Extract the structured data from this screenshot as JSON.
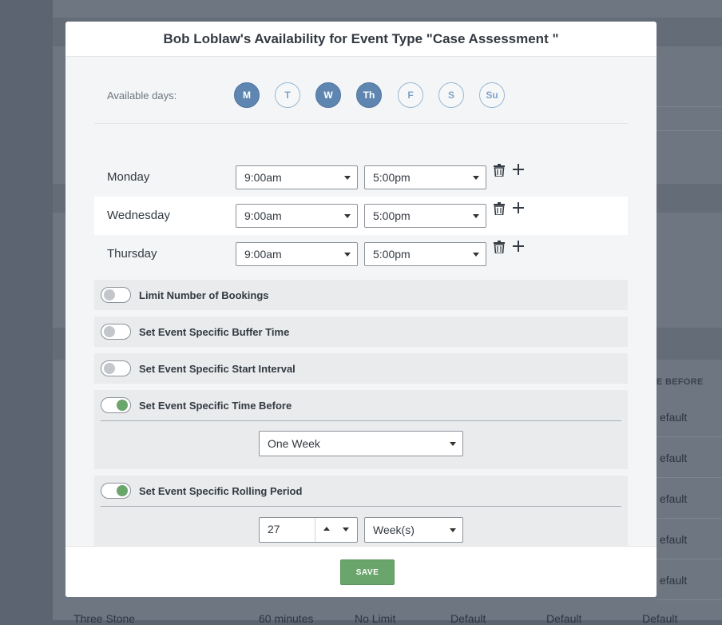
{
  "modal": {
    "title": "Bob Loblaw's Availability for Event Type \"Case Assessment \"",
    "available_days_label": "Available days:",
    "days": [
      {
        "label": "M",
        "selected": true
      },
      {
        "label": "T",
        "selected": false
      },
      {
        "label": "W",
        "selected": true
      },
      {
        "label": "Th",
        "selected": true
      },
      {
        "label": "F",
        "selected": false
      },
      {
        "label": "S",
        "selected": false
      },
      {
        "label": "Su",
        "selected": false
      }
    ],
    "schedule": [
      {
        "day": "Monday",
        "start": "9:00am",
        "end": "5:00pm"
      },
      {
        "day": "Wednesday",
        "start": "9:00am",
        "end": "5:00pm"
      },
      {
        "day": "Thursday",
        "start": "9:00am",
        "end": "5:00pm"
      }
    ],
    "options": {
      "limit_bookings": {
        "label": "Limit Number of Bookings",
        "enabled": false
      },
      "buffer_time": {
        "label": "Set Event Specific Buffer Time",
        "enabled": false
      },
      "start_interval": {
        "label": "Set Event Specific Start Interval",
        "enabled": false
      },
      "time_before": {
        "label": "Set Event Specific Time Before",
        "enabled": true,
        "value": "One Week"
      },
      "rolling_period": {
        "label": "Set Event Specific Rolling Period",
        "enabled": true,
        "amount": "27",
        "unit": "Week(s)"
      }
    },
    "save_label": "SAVE"
  },
  "background": {
    "header_partial": "E BEFORE",
    "cells": [
      "efault",
      "efault",
      "efault",
      "efault",
      "efault"
    ],
    "bottom_row": [
      "Three Stone",
      "60 minutes",
      "No Limit",
      "Default",
      "Default",
      "Default"
    ]
  },
  "colors": {
    "accent_blue": "#5f86b0",
    "save_green": "#6aa56b"
  }
}
